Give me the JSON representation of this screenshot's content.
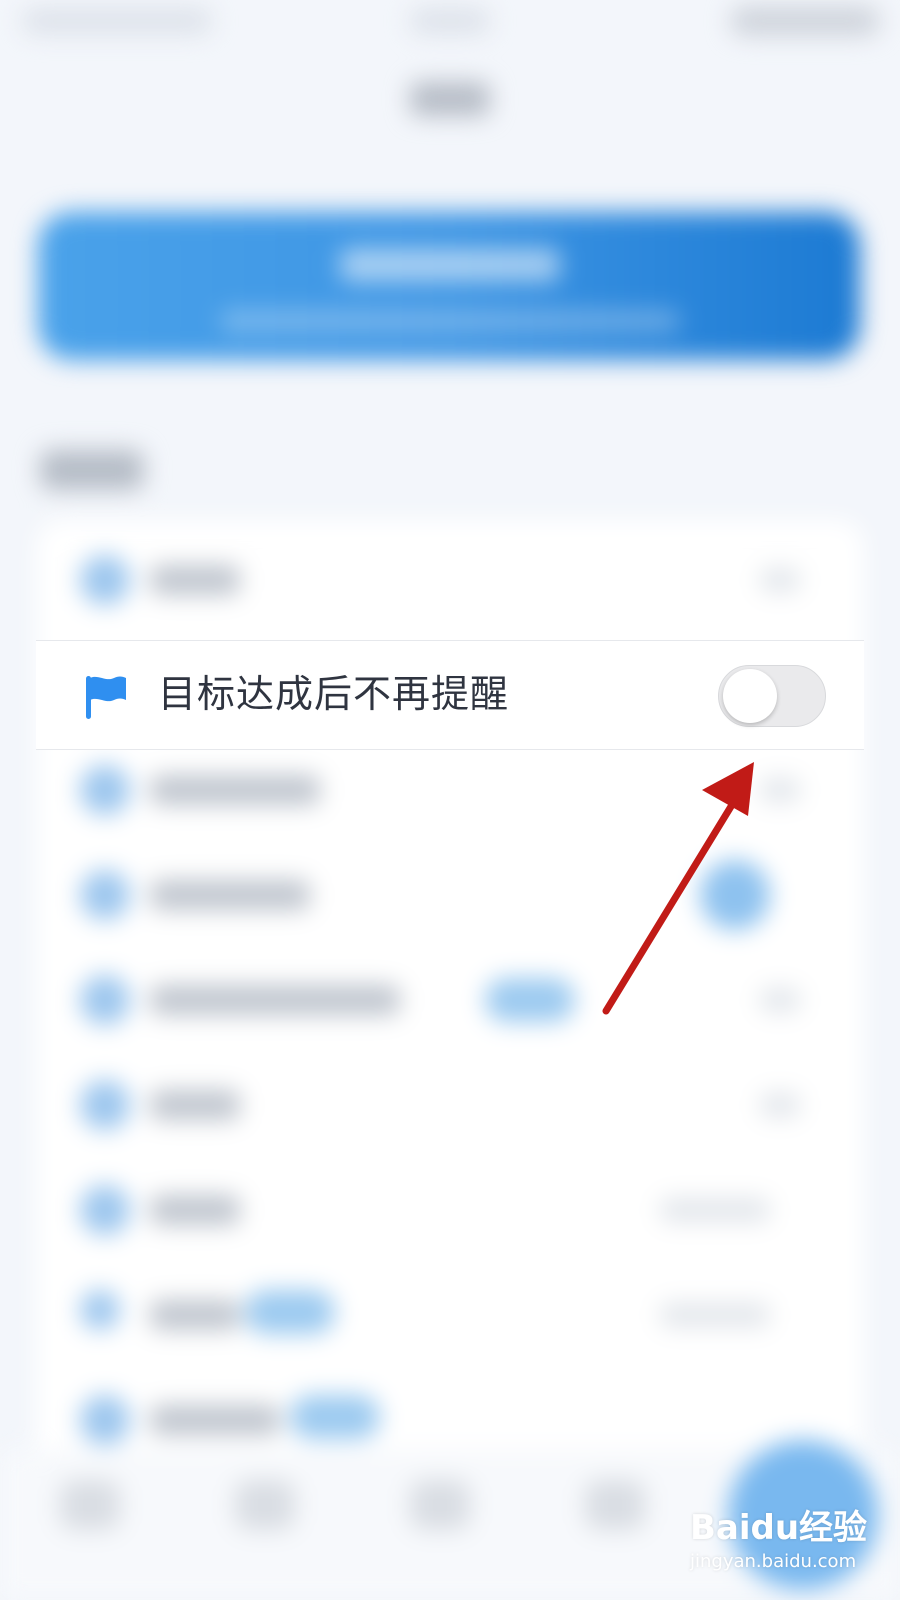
{
  "setting_row": {
    "label": "目标达成后不再提醒",
    "icon": "flag-icon",
    "toggle_state": "off"
  },
  "watermark": {
    "logo_text": "Baidu经验",
    "sub_text": "jingyan.baidu.com"
  },
  "colors": {
    "accent_blue": "#3d95e4",
    "arrow_red": "#c11b17",
    "label_text": "#2f3440"
  }
}
